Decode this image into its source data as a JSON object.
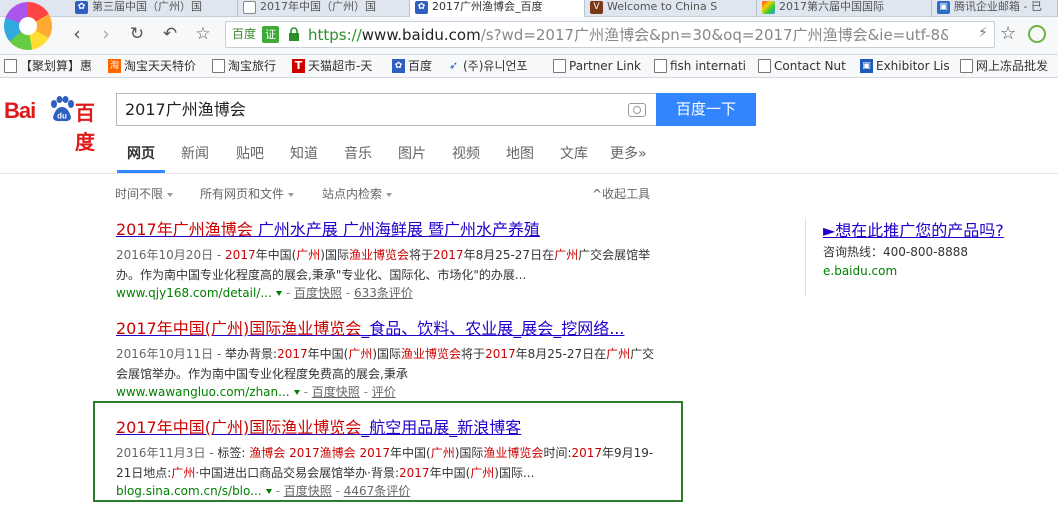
{
  "browser": {
    "tabs": [
      {
        "label": "第三届中国（广州）国",
        "icon": "paw"
      },
      {
        "label": "2017年中国（广州）国",
        "icon": "page"
      },
      {
        "label": "2017广州渔博会_百度",
        "icon": "paw"
      },
      {
        "label": "Welcome to China S",
        "icon": "v"
      },
      {
        "label": "2017第六届中国国际",
        "icon": "color"
      },
      {
        "label": "腾讯企业邮箱 - 已",
        "icon": "mail"
      }
    ],
    "address": {
      "badge_text": "百度",
      "cert_text": "证",
      "url_https": "https://",
      "url_host": "www.baidu.com",
      "url_rest": "/s?wd=2017广州渔博会&pn=30&oq=2017广州渔博会&ie=utf-8&"
    },
    "bookmarks": [
      {
        "label": "【聚划算】惠",
        "icon": "page"
      },
      {
        "label": "淘宝天天特价",
        "icon": "taobao"
      },
      {
        "label": "淘宝旅行",
        "icon": "page"
      },
      {
        "label": "天猫超市-天",
        "icon": "tmall"
      },
      {
        "label": "百度",
        "icon": "paw"
      },
      {
        "label": "(주)유니언포",
        "icon": "fish"
      },
      {
        "label": "Partner Link",
        "icon": "page"
      },
      {
        "label": "fish internati",
        "icon": "page"
      },
      {
        "label": "Contact Nut",
        "icon": "page"
      },
      {
        "label": "Exhibitor Lis",
        "icon": "blue"
      },
      {
        "label": "网上冻品批发",
        "icon": "page"
      }
    ]
  },
  "baidu": {
    "logo_bai": "Bai",
    "logo_du": "du",
    "logo_cn": "百度",
    "query": "2017广州渔博会",
    "search_button": "百度一下",
    "tabs": [
      "网页",
      "新闻",
      "贴吧",
      "知道",
      "音乐",
      "图片",
      "视频",
      "地图",
      "文库",
      "更多»"
    ],
    "tools": {
      "time": "时间不限",
      "filetype": "所有网页和文件",
      "site": "站点内检索",
      "collapse": "^收起工具"
    }
  },
  "results": [
    {
      "title_parts": [
        {
          "t": "2017年广州渔博会",
          "em": true
        },
        {
          "t": " 广州水产展 广州海鲜展 暨广州水产养殖",
          "em": false
        }
      ],
      "date": "2016年10月20日 - ",
      "desc_parts": [
        {
          "t": "2017",
          "em": true
        },
        {
          "t": "年中国(",
          "em": false
        },
        {
          "t": "广州",
          "em": true
        },
        {
          "t": ")国际",
          "em": false
        },
        {
          "t": "渔业博览会",
          "em": true
        },
        {
          "t": "将于",
          "em": false
        },
        {
          "t": "2017",
          "em": true
        },
        {
          "t": "年8月25-27日在",
          "em": false
        },
        {
          "t": "广州",
          "em": true
        },
        {
          "t": "广交会展馆举办。作为南中国专业化程度高的展会,秉承\"专业化、国际化、市场化\"的办展...",
          "em": false
        }
      ],
      "url": "www.qjy168.com/detail/...",
      "snapshot": "百度快照",
      "reviews": "633条评价"
    },
    {
      "title_parts": [
        {
          "t": "2017年中国(广州)国际渔业博览会",
          "em": true
        },
        {
          "t": "_食品、饮料、农业展_展会_挖网络...",
          "em": false
        }
      ],
      "date": "2016年10月11日 - ",
      "desc_parts": [
        {
          "t": "举办背景:",
          "em": false
        },
        {
          "t": "2017",
          "em": true
        },
        {
          "t": "年中国(",
          "em": false
        },
        {
          "t": "广州",
          "em": true
        },
        {
          "t": ")国际",
          "em": false
        },
        {
          "t": "渔业博览会",
          "em": true
        },
        {
          "t": "将于",
          "em": false
        },
        {
          "t": "2017",
          "em": true
        },
        {
          "t": "年8月25-27日在",
          "em": false
        },
        {
          "t": "广州",
          "em": true
        },
        {
          "t": "广交会展馆举办。作为南中国专业化程度免费高的展会,秉承",
          "em": false
        }
      ],
      "url": "www.wawangluo.com/zhan...",
      "snapshot": "百度快照",
      "reviews": "评价"
    },
    {
      "title_parts": [
        {
          "t": "2017年中国(广州)国际渔业博览会",
          "em": true
        },
        {
          "t": "_航空用品展_新浪博客",
          "em": false
        }
      ],
      "date": "2016年11月3日 - ",
      "desc_parts": [
        {
          "t": "标签: ",
          "em": false
        },
        {
          "t": "渔博会",
          "em": true
        },
        {
          "t": " ",
          "em": false
        },
        {
          "t": "2017渔博会",
          "em": true
        },
        {
          "t": " ",
          "em": false
        },
        {
          "t": "2017",
          "em": true
        },
        {
          "t": "年中国(",
          "em": false
        },
        {
          "t": "广州",
          "em": true
        },
        {
          "t": ")国际",
          "em": false
        },
        {
          "t": "渔业博览会",
          "em": true
        },
        {
          "t": "时间:",
          "em": false
        },
        {
          "t": "2017",
          "em": true
        },
        {
          "t": "年9月19-21日地点:",
          "em": false
        },
        {
          "t": "广州",
          "em": true
        },
        {
          "t": "·中国进出口商品交易会展馆举办·背景:",
          "em": false
        },
        {
          "t": "2017",
          "em": true
        },
        {
          "t": "年中国(",
          "em": false
        },
        {
          "t": "广州",
          "em": true
        },
        {
          "t": ")国际...",
          "em": false
        }
      ],
      "url": "blog.sina.com.cn/s/blo...",
      "snapshot": "百度快照",
      "reviews": "4467条评价"
    }
  ],
  "ad": {
    "title": "►想在此推广您的产品吗?",
    "phone_label": "咨询热线：",
    "phone": "400-800-8888",
    "url": "e.baidu.com"
  },
  "colors": {
    "link": "#2200cc",
    "highlight": "#c00",
    "url_green": "#008000",
    "search_button": "#3385ff",
    "selection_box": "#2e7d2e"
  }
}
